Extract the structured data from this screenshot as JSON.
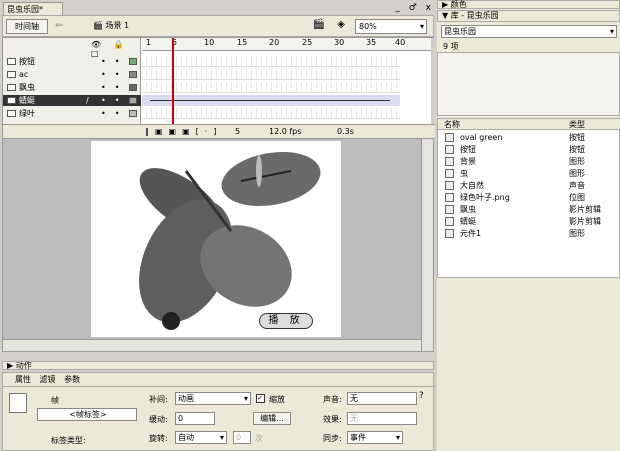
{
  "document": {
    "tab": "昆虫乐园*",
    "window_controls": "_ ♂ x"
  },
  "toolbar": {
    "timeline_button": "时间轴",
    "scene": "场景 1",
    "zoom": "80%"
  },
  "timeline": {
    "ruler": [
      "1",
      "5",
      "10",
      "15",
      "20",
      "25",
      "30",
      "35",
      "40"
    ],
    "layers": [
      {
        "name": "按钮",
        "sel": false
      },
      {
        "name": "ac",
        "sel": false
      },
      {
        "name": "飘虫",
        "sel": false
      },
      {
        "name": "蜻蜓",
        "sel": true
      },
      {
        "name": "绿叶",
        "sel": false
      }
    ],
    "status": {
      "frame": "5",
      "fps": "12.0 fps",
      "time": "0.3s"
    }
  },
  "stage": {
    "play_button": "播 放"
  },
  "panels": {
    "actions": "▶ 动作"
  },
  "properties": {
    "tabs": [
      "属性",
      "滤镜",
      "参数"
    ],
    "frame_label": "帧",
    "frame_name_placeholder": "<帧标签>",
    "label_type": "标签类型:",
    "tween_label": "补间:",
    "tween_value": "动画",
    "scale_label": "缩放",
    "ease_label": "缓动:",
    "ease_value": "0",
    "edit_button": "编辑...",
    "rotate_label": "旋转:",
    "rotate_value": "自动",
    "rotate_times": "0",
    "rotate_unit": "次",
    "sound_label": "声音:",
    "sound_value": "无",
    "effect_label": "效果:",
    "effect_value": "无",
    "sync_label": "同步:",
    "sync_value": "事件"
  },
  "library": {
    "color_panel": "▶ 颜色",
    "title": "▼ 库 - 昆虫乐园",
    "doc_select": "昆虫乐园",
    "count": "9 项",
    "col_name": "名称",
    "col_type": "类型",
    "items": [
      {
        "name": "oval green",
        "type": "按钮"
      },
      {
        "name": "按钮",
        "type": "按钮"
      },
      {
        "name": "背景",
        "type": "图形"
      },
      {
        "name": "虫",
        "type": "图形"
      },
      {
        "name": "大自然",
        "type": "声音"
      },
      {
        "name": "绿色叶子.png",
        "type": "位图"
      },
      {
        "name": "飘虫",
        "type": "影片剪辑"
      },
      {
        "name": "蜻蜓",
        "type": "影片剪辑"
      },
      {
        "name": "元件1",
        "type": "图形"
      }
    ]
  }
}
